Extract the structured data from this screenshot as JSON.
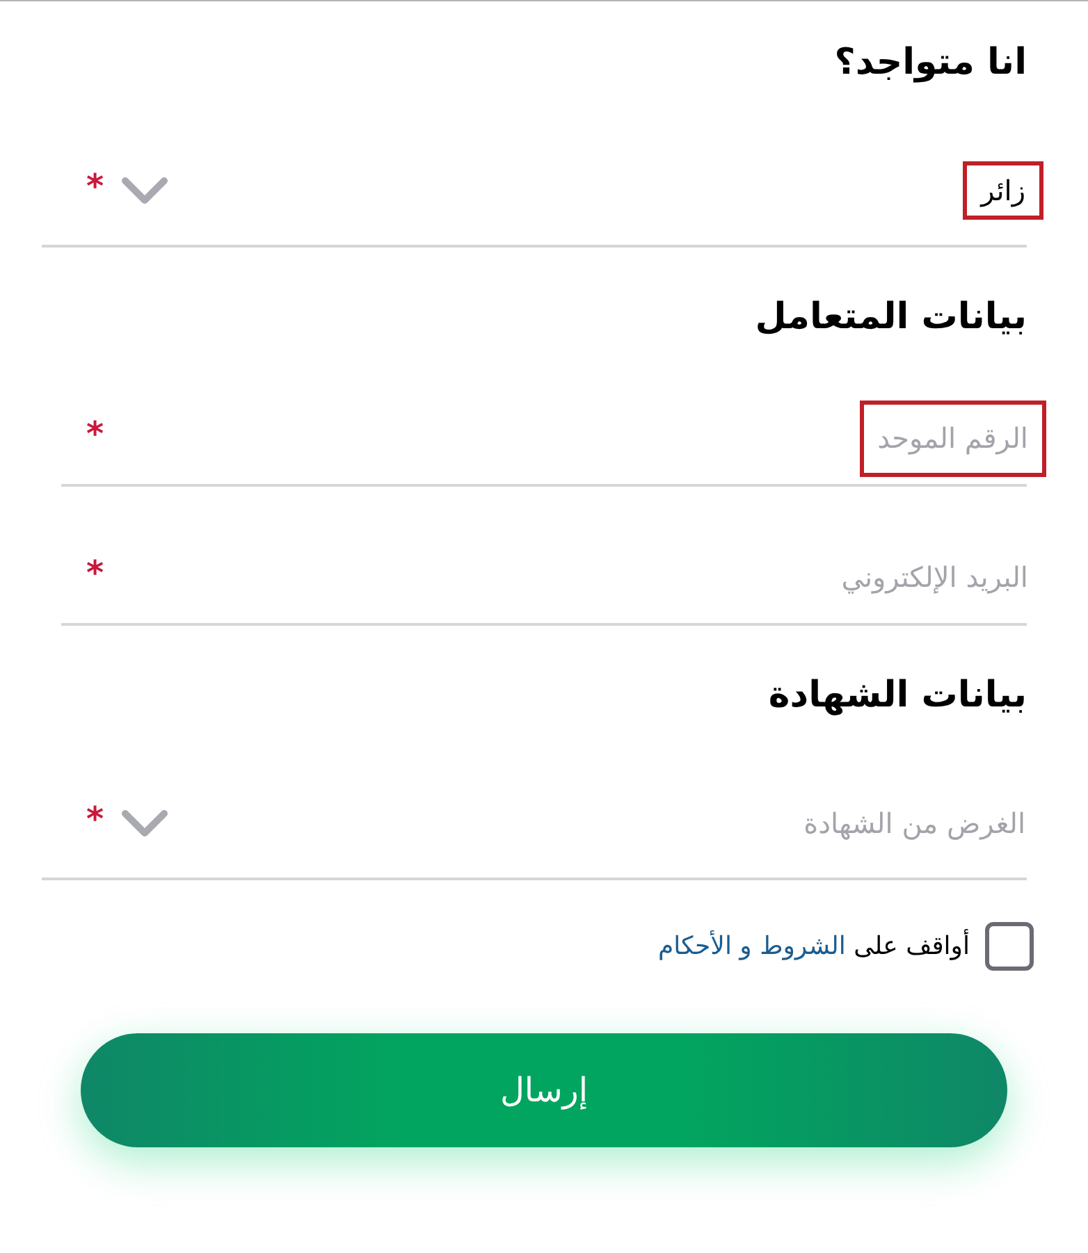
{
  "sections": [
    {
      "title": "انا متواجد؟",
      "fields": [
        {
          "kind": "select",
          "value": "زائر",
          "required_mark": "*",
          "highlighted": true
        }
      ]
    },
    {
      "title": "بيانات المتعامل",
      "fields": [
        {
          "kind": "input",
          "placeholder": "الرقم الموحد",
          "required_mark": "*",
          "highlighted": true
        },
        {
          "kind": "input",
          "placeholder": "البريد الإلكتروني",
          "required_mark": "*",
          "highlighted": false
        }
      ]
    },
    {
      "title": "بيانات الشهادة",
      "fields": [
        {
          "kind": "select",
          "placeholder": "الغرض من الشهادة",
          "required_mark": "*",
          "highlighted": false
        }
      ]
    }
  ],
  "agreement": {
    "checked": false,
    "text": "أواقف على",
    "link": "الشروط و الأحكام"
  },
  "submit_button": {
    "label": "إرسال"
  }
}
